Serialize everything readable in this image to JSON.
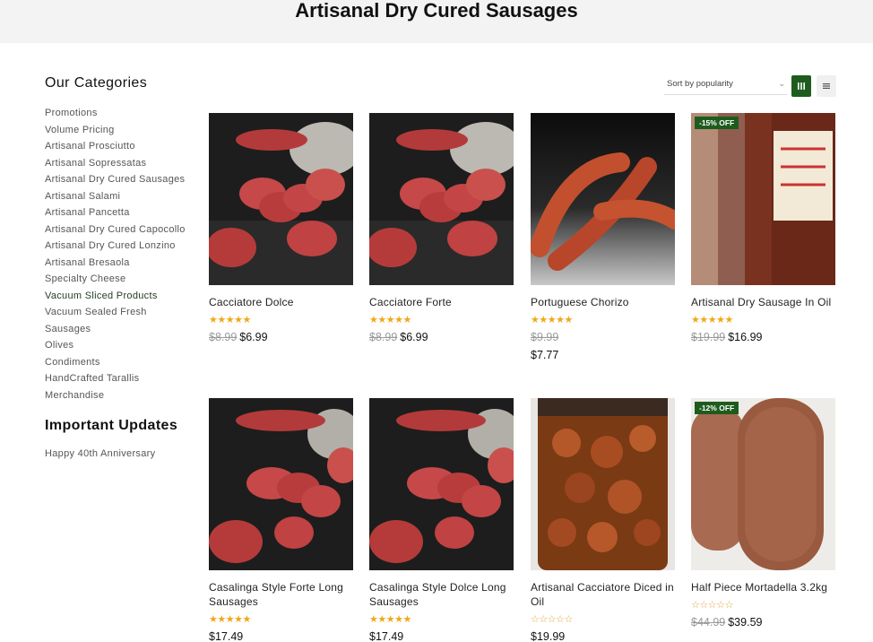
{
  "page": {
    "title": "Artisanal Dry Cured Sausages"
  },
  "sidebar": {
    "heading": "Our Categories",
    "categories": [
      {
        "label": "Promotions"
      },
      {
        "label": "Volume Pricing"
      },
      {
        "label": "Artisanal Prosciutto"
      },
      {
        "label": "Artisanal Sopressatas"
      },
      {
        "label": "Artisanal Dry Cured Sausages"
      },
      {
        "label": "Artisanal Salami"
      },
      {
        "label": "Artisanal Pancetta"
      },
      {
        "label": "Artisanal Dry Cured Capocollo"
      },
      {
        "label": "Artisanal Dry Cured Lonzino"
      },
      {
        "label": "Artisanal Bresaola"
      },
      {
        "label": "Specialty Cheese"
      },
      {
        "label": "Vacuum Sliced Products"
      },
      {
        "label": "Vacuum Sealed Fresh"
      },
      {
        "label": "Sausages"
      },
      {
        "label": "Olives"
      },
      {
        "label": "Condiments"
      },
      {
        "label": "HandCrafted Tarallis"
      },
      {
        "label": "Merchandise"
      }
    ],
    "updates_heading": "Important Updates",
    "updates": [
      {
        "label": "Happy 40th Anniversary"
      }
    ]
  },
  "toolbar": {
    "sort_label": "Sort by popularity",
    "grid_icon": "grid-view-icon",
    "list_icon": "list-view-icon"
  },
  "colors": {
    "accent": "#1e5c1e",
    "star": "#f0a81a",
    "title_bar": "#f3f3f3"
  },
  "products": [
    {
      "name": "Cacciatore Dolce",
      "rating": "★★★★★",
      "old_price": "$8.99",
      "price": "$6.99",
      "badge": ""
    },
    {
      "name": "Cacciatore Forte",
      "rating": "★★★★★",
      "old_price": "$8.99",
      "price": "$6.99",
      "badge": ""
    },
    {
      "name": "Portuguese Chorizo",
      "rating": "★★★★★",
      "old_price": "$9.99",
      "price": "$7.77",
      "badge": ""
    },
    {
      "name": "Artisanal Dry Sausage In Oil",
      "rating": "★★★★★",
      "old_price": "$19.99",
      "price": "$16.99",
      "badge": "-15% OFF"
    },
    {
      "name": "Casalinga Style Forte Long Sausages",
      "rating": "★★★★★",
      "old_price": "",
      "price": "$17.49",
      "badge": ""
    },
    {
      "name": "Casalinga Style Dolce Long Sausages",
      "rating": "★★★★★",
      "old_price": "",
      "price": "$17.49",
      "badge": ""
    },
    {
      "name": "Artisanal Cacciatore Diced in Oil",
      "rating": "☆☆☆☆☆",
      "old_price": "",
      "price": "$19.99",
      "badge": ""
    },
    {
      "name": "Half Piece Mortadella 3.2kg",
      "rating": "☆☆☆☆☆",
      "old_price": "$44.99",
      "price": "$39.59",
      "badge": "-12% OFF"
    }
  ]
}
